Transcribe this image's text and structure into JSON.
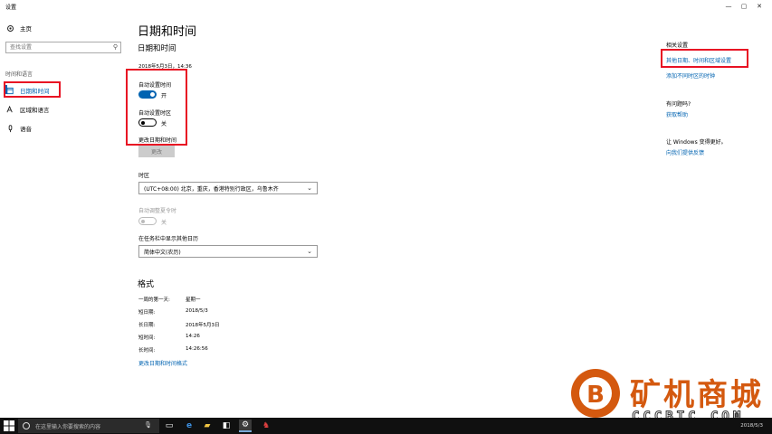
{
  "window": {
    "title": "设置",
    "minimize": "—",
    "maximize": "▢",
    "close": "✕"
  },
  "sidebar": {
    "home_label": "主页",
    "search_placeholder": "查找设置",
    "section_label": "时间和语言",
    "items": [
      {
        "label": "日期和时间"
      },
      {
        "label": "区域和语言"
      },
      {
        "label": "语音"
      }
    ]
  },
  "main": {
    "page_title": "日期和时间",
    "sub_title": "日期和时间",
    "current_datetime": "2018年5月3日，14:36",
    "auto_time_label": "自动设置时间",
    "auto_time_state": "开",
    "auto_tz_label": "自动设置时区",
    "auto_tz_state": "关",
    "change_dt_label": "更改日期和时间",
    "change_button": "更改",
    "timezone_label": "时区",
    "timezone_value": "(UTC+08:00) 北京，重庆，香港特别行政区，乌鲁木齐",
    "dst_label": "自动调整夏令时",
    "dst_state": "关",
    "calendar_label": "在任务栏中显示其他日历",
    "calendar_value": "简体中文(农历)",
    "format_title": "格式",
    "format_rows": [
      {
        "key": "一周的第一天:",
        "value": "星期一"
      },
      {
        "key": "短日期:",
        "value": "2018/5/3"
      },
      {
        "key": "长日期:",
        "value": "2018年5月3日"
      },
      {
        "key": "短时间:",
        "value": "14:26"
      },
      {
        "key": "长时间:",
        "value": "14:26:56"
      }
    ],
    "change_format_link": "更改日期和时间格式"
  },
  "right": {
    "related_title": "相关设置",
    "related_link1": "其他日期、时间和区域设置",
    "related_link2": "添加不同时区的时钟",
    "question_title": "有问题吗?",
    "help_link": "获取帮助",
    "better_title": "让 Windows 变得更好。",
    "feedback_link": "向我们提供反馈"
  },
  "taskbar": {
    "search_placeholder": "在这里输入你要搜索的内容",
    "date": "2018/5/3"
  },
  "watermark": {
    "text": "矿机商城",
    "sub": "CCCBTC.COM"
  },
  "colors": {
    "accent": "#0063b1",
    "highlight_box": "#e81123",
    "taskbar": "#101010",
    "watermark": "#d4590f"
  }
}
